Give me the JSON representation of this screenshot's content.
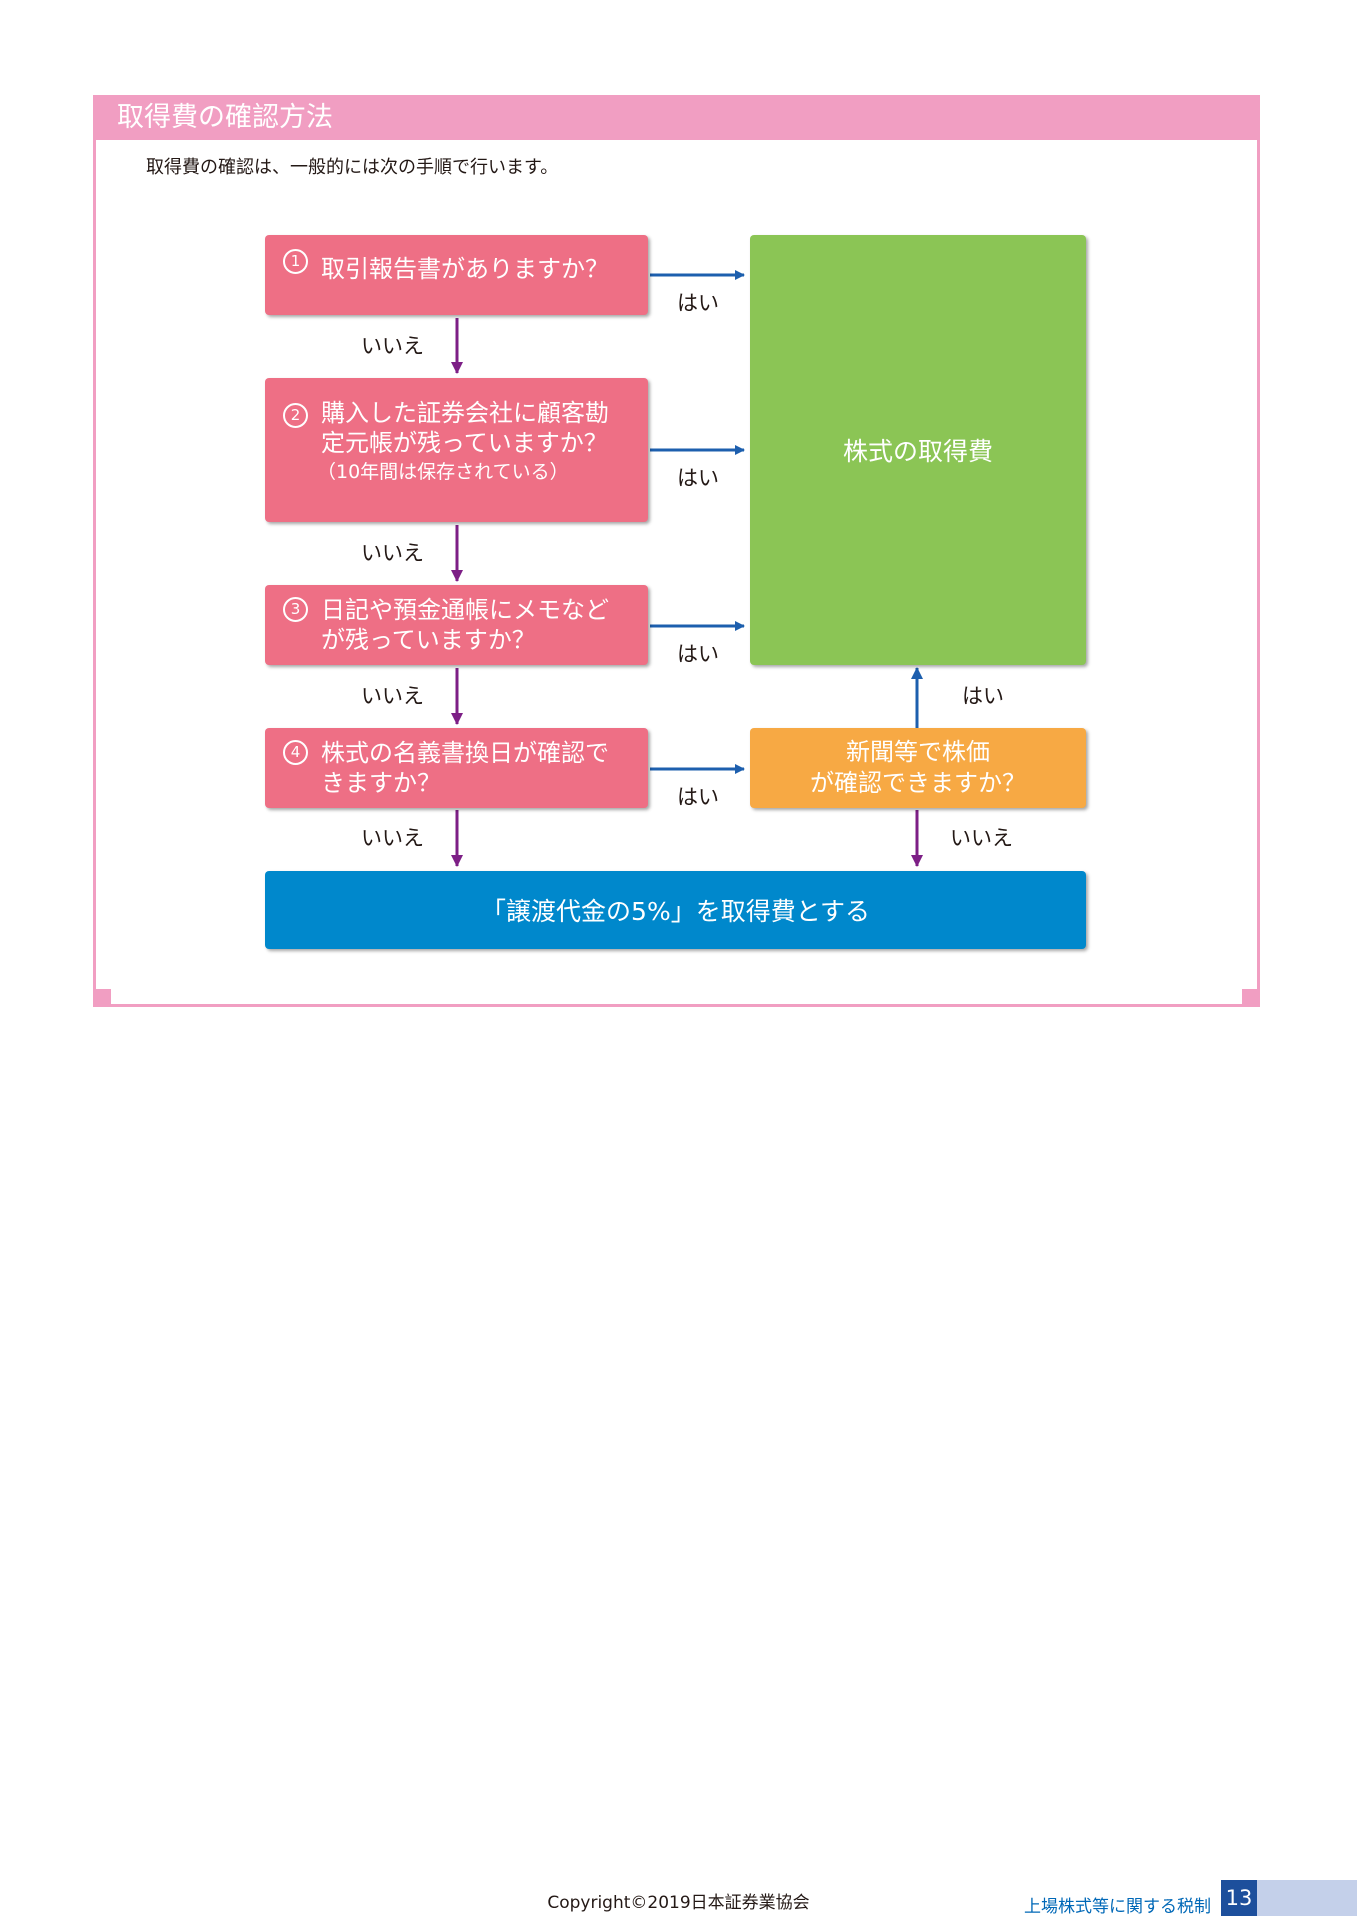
{
  "section": {
    "title": "取得費の確認方法",
    "intro": "取得費の確認は、一般的には次の手順で行います。"
  },
  "flow": {
    "q1": {
      "num": "1",
      "text": "取引報告書がありますか？"
    },
    "q2": {
      "num": "2",
      "text_line1": "購入した証券会社に顧客勘",
      "text_line2": "定元帳が残っていますか？",
      "note": "（10年間は保存されている）"
    },
    "q3": {
      "num": "3",
      "text_line1": "日記や預金通帳にメモなど",
      "text_line2": "が残っていますか？"
    },
    "q4": {
      "num": "4",
      "text_line1": "株式の名義書換日が確認で",
      "text_line2": "きますか？"
    },
    "result_cost": "株式の取得費",
    "newspaper_line1": "新聞等で株価",
    "newspaper_line2": "が確認できますか？",
    "fallback": "「譲渡代金の5%」を取得費とする",
    "yes": "はい",
    "no": "いいえ"
  },
  "colors": {
    "header_pink": "#f19ec2",
    "question_pink": "#ee6f85",
    "result_green": "#8bc555",
    "newspaper_orange": "#f7a944",
    "fallback_blue": "#0088cc",
    "yes_arrow": "#1d5fae",
    "no_arrow": "#7d1f86"
  },
  "footer": {
    "title": "上場株式等に関する税制",
    "page_number": "13",
    "copyright": "Copyright©2019日本証券業協会"
  }
}
